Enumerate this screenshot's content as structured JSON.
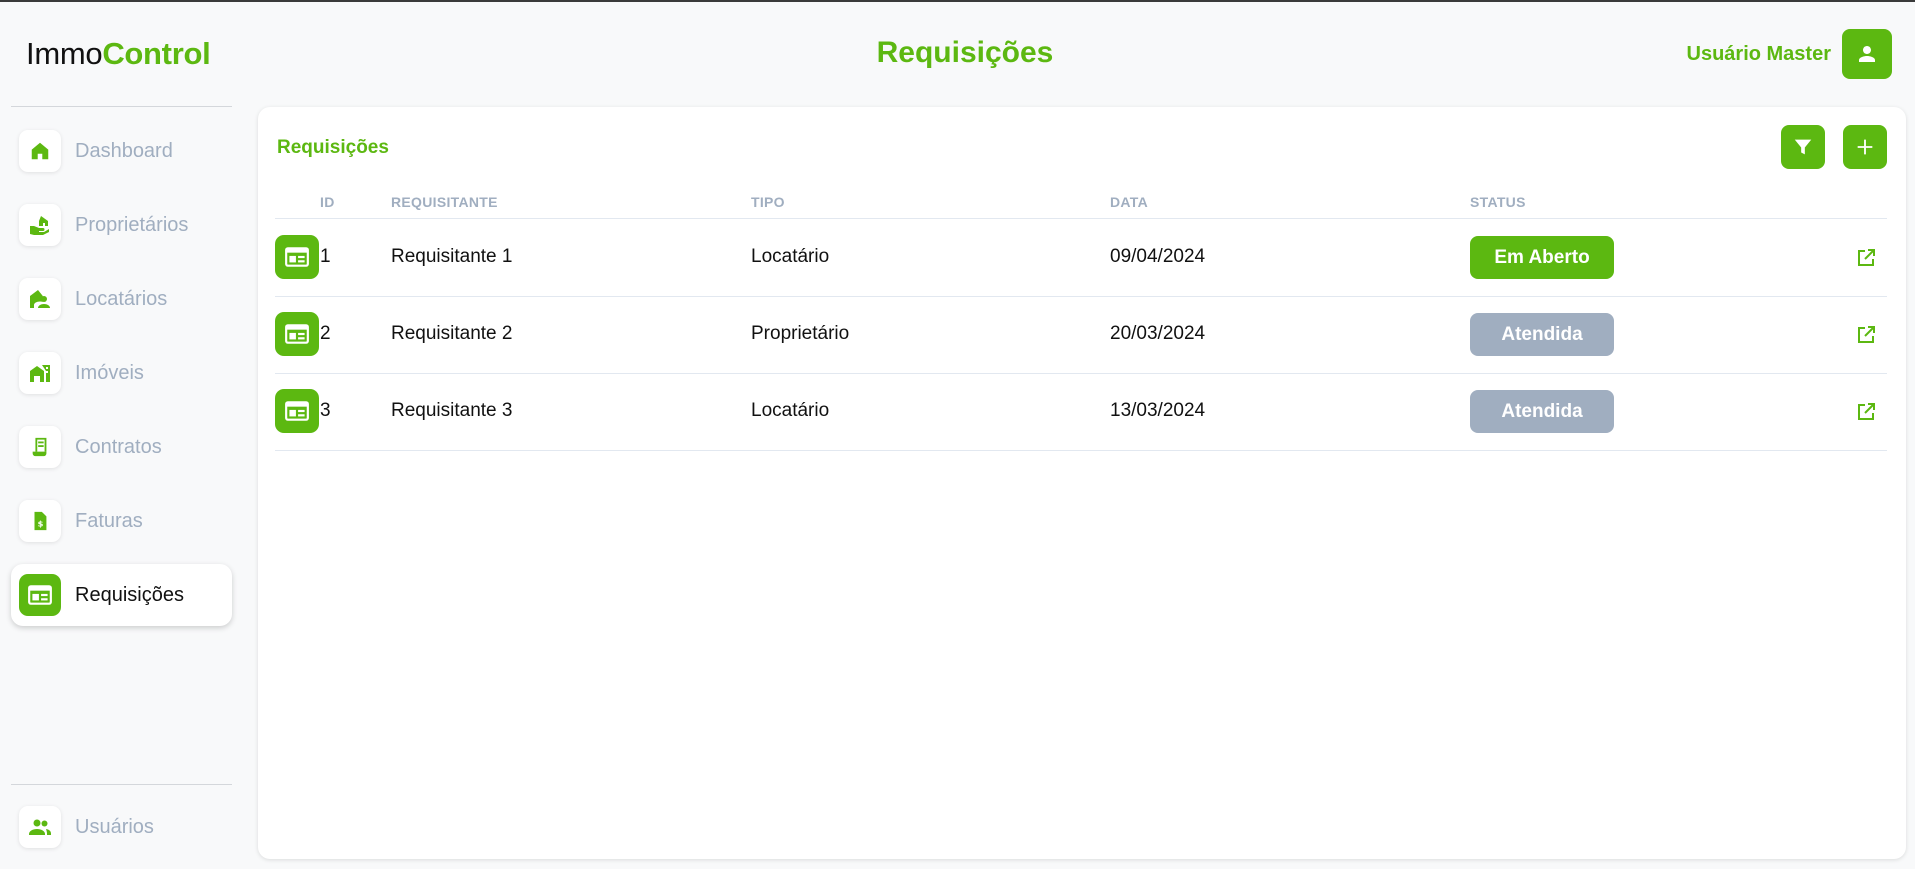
{
  "app": {
    "logo_part1": "Immo",
    "logo_part2": "Control"
  },
  "header": {
    "title": "Requisições",
    "user_name": "Usuário Master",
    "user_icon": "person-icon"
  },
  "sidebar": {
    "items": [
      {
        "label": "Dashboard",
        "icon": "home-icon",
        "active": false
      },
      {
        "label": "Proprietários",
        "icon": "hand-house-icon",
        "active": false
      },
      {
        "label": "Locatários",
        "icon": "person-house-icon",
        "active": false
      },
      {
        "label": "Imóveis",
        "icon": "buildings-icon",
        "active": false
      },
      {
        "label": "Contratos",
        "icon": "scroll-icon",
        "active": false
      },
      {
        "label": "Faturas",
        "icon": "invoice-icon",
        "active": false
      },
      {
        "label": "Requisições",
        "icon": "table-card-icon",
        "active": true
      }
    ],
    "footer_item": {
      "label": "Usuários",
      "icon": "people-icon"
    }
  },
  "card": {
    "title": "Requisições",
    "filter_icon": "filter-icon",
    "add_icon": "plus-icon"
  },
  "table": {
    "columns": [
      "ID",
      "REQUISITANTE",
      "TIPO",
      "DATA",
      "STATUS"
    ],
    "rows": [
      {
        "id": "1",
        "requisitante": "Requisitante 1",
        "tipo": "Locatário",
        "data": "09/04/2024",
        "status": "Em Aberto",
        "status_kind": "open"
      },
      {
        "id": "2",
        "requisitante": "Requisitante 2",
        "tipo": "Proprietário",
        "data": "20/03/2024",
        "status": "Atendida",
        "status_kind": "done"
      },
      {
        "id": "3",
        "requisitante": "Requisitante 3",
        "tipo": "Locatário",
        "data": "13/03/2024",
        "status": "Atendida",
        "status_kind": "done"
      }
    ]
  },
  "colors": {
    "accent": "#5cb811",
    "muted": "#a0aec0",
    "status_done": "#a0aec0"
  }
}
